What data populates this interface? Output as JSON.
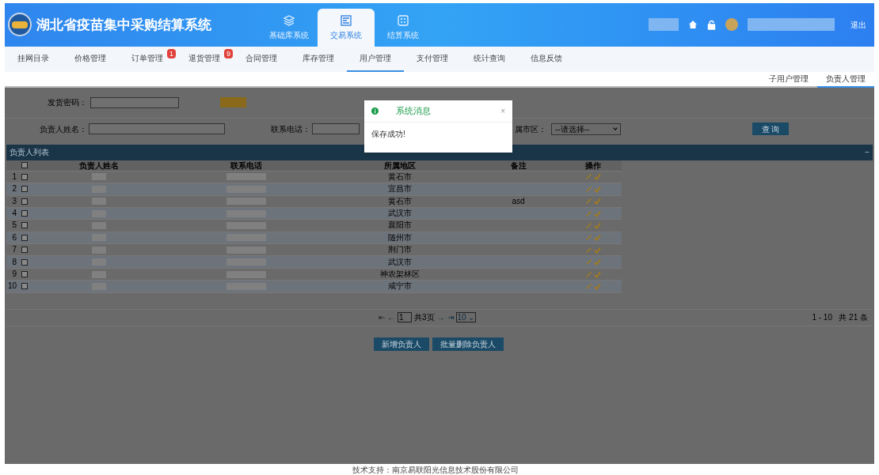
{
  "header": {
    "title": "湖北省疫苗集中采购结算系统",
    "systems": [
      {
        "label": "基础库系统",
        "selected": false
      },
      {
        "label": "交易系统",
        "selected": true
      },
      {
        "label": "结算系统",
        "selected": false
      }
    ],
    "logout": "退出"
  },
  "nav": [
    {
      "label": "挂网目录",
      "selected": false
    },
    {
      "label": "价格管理",
      "selected": false
    },
    {
      "label": "订单管理",
      "badge": "1",
      "selected": false
    },
    {
      "label": "退货管理",
      "badge": "9",
      "selected": false
    },
    {
      "label": "合同管理",
      "selected": false
    },
    {
      "label": "库存管理",
      "selected": false
    },
    {
      "label": "用户管理",
      "selected": true
    },
    {
      "label": "支付管理",
      "selected": false
    },
    {
      "label": "统计查询",
      "selected": false
    },
    {
      "label": "信息反馈",
      "selected": false
    }
  ],
  "subtabs": [
    {
      "label": "子用户管理",
      "selected": false
    },
    {
      "label": "负责人管理",
      "selected": true
    }
  ],
  "form": {
    "password_label": "发货密码：",
    "name_label": "负责人姓名：",
    "phone_label": "联系电话：",
    "region_label": "属市区：",
    "region_select": "--请选择--",
    "query_button": "查 询"
  },
  "dialog": {
    "title": "系统消息",
    "close": "×",
    "message": "保存成功!"
  },
  "panel": {
    "title": "负责人列表",
    "collapse": "−"
  },
  "table": {
    "select_all_checked": false,
    "columns": [
      "负责人姓名",
      "联系电话",
      "所属地区",
      "备注",
      "操作"
    ],
    "rows": [
      {
        "index": "1",
        "checked": false,
        "region": "黄石市",
        "note": ""
      },
      {
        "index": "2",
        "checked": false,
        "region": "宜昌市",
        "note": ""
      },
      {
        "index": "3",
        "checked": false,
        "region": "黄石市",
        "note": "asd"
      },
      {
        "index": "4",
        "checked": false,
        "region": "武汉市",
        "note": ""
      },
      {
        "index": "5",
        "checked": false,
        "region": "襄阳市",
        "note": ""
      },
      {
        "index": "6",
        "checked": false,
        "region": "随州市",
        "note": ""
      },
      {
        "index": "7",
        "checked": false,
        "region": "荆门市",
        "note": ""
      },
      {
        "index": "8",
        "checked": false,
        "region": "武汉市",
        "note": ""
      },
      {
        "index": "9",
        "checked": false,
        "region": "神农架林区",
        "note": ""
      },
      {
        "index": "10",
        "checked": false,
        "region": "咸宁市",
        "note": ""
      }
    ]
  },
  "pagination": {
    "first": "⇤",
    "prev": "←",
    "page": "1",
    "total_pages": "共3页",
    "next": "→",
    "last": "⇥",
    "page_size": "10",
    "page_size_caret": "⌄",
    "summary": "1 - 10   共 21 条"
  },
  "actions": [
    "新增负责人",
    "批量删除负责人"
  ],
  "footer": "技术支持：南京易联阳光信息技术股份有限公司"
}
